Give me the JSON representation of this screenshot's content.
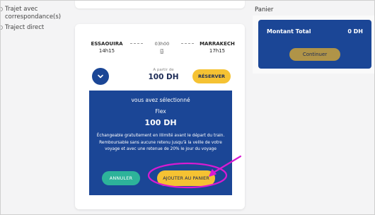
{
  "filters": {
    "items": [
      {
        "label": "Trajet avec correspondance(s)"
      },
      {
        "label": "Traject direct"
      }
    ]
  },
  "offer": {
    "departure": {
      "station": "ESSAOUIRA",
      "time": "14h15"
    },
    "arrival": {
      "station": "MARRAKECH",
      "time": "17h15"
    },
    "duration": "03h00",
    "price_from_label": "A partir de",
    "price": "100 DH",
    "reserve_label": "RÉSERVER",
    "detail": {
      "selected_label": "vous avez sélectionné",
      "fare_name": "Flex",
      "fare_price": "100 DH",
      "description": "Échangeable gratuitement en illimité avant le départ du train. Remboursable sans aucune retenu jusqu'à la veille de votre voyage et avec une retenue de 20% le jour du voyage",
      "cancel_label": "ANNULER",
      "add_to_cart_label": "AJOUTER AU PANIER"
    }
  },
  "cart": {
    "title": "Panier",
    "total_label": "Montant Total",
    "total_value": "0 DH",
    "continue_label": "Continuer"
  },
  "colors": {
    "primary_blue": "#1b4696",
    "accent_yellow": "#f5c233",
    "teal": "#2db39a",
    "annotation_magenta": "#d81bd2"
  }
}
